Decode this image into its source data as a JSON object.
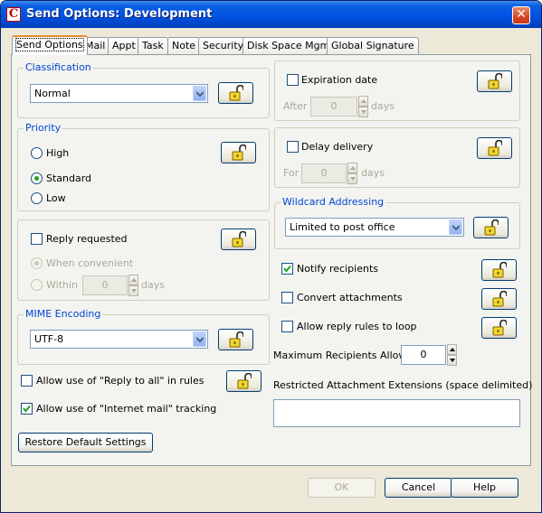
{
  "window": {
    "title": "Send Options:  Development",
    "app_icon": "C"
  },
  "tabs": [
    "Send Options",
    "Mail",
    "Appt",
    "Task",
    "Note",
    "Security",
    "Disk Space Mgmt",
    "Global Signature"
  ],
  "classification": {
    "legend": "Classification",
    "value": "Normal"
  },
  "priority": {
    "legend": "Priority",
    "options": [
      "High",
      "Standard",
      "Low"
    ],
    "selected": "Standard"
  },
  "reply": {
    "label": "Reply requested",
    "checked": false,
    "when_convenient": "When convenient",
    "within": "Within",
    "within_value": "0",
    "days": "days"
  },
  "mime": {
    "legend": "MIME Encoding",
    "value": "UTF-8"
  },
  "allow_reply_all": {
    "label": "Allow use of  \"Reply to all\" in rules",
    "checked": false
  },
  "allow_internet_tracking": {
    "label": "Allow use of  \"Internet mail\" tracking",
    "checked": true
  },
  "restore_button": "Restore Default Settings",
  "expiration": {
    "label": "Expiration date",
    "checked": false,
    "after": "After",
    "value": "0",
    "days": "days"
  },
  "delay": {
    "label": "Delay delivery",
    "checked": false,
    "for": "For",
    "value": "0",
    "days": "days"
  },
  "wildcard": {
    "legend": "Wildcard Addressing",
    "value": "Limited to post office"
  },
  "notify": {
    "label": "Notify recipients",
    "checked": true
  },
  "convert": {
    "label": "Convert attachments",
    "checked": false
  },
  "reply_rules_loop": {
    "label": "Allow reply rules to loop",
    "checked": false
  },
  "max_recipients": {
    "label": "Maximum Recipients Allowed",
    "value": "0"
  },
  "restricted_ext": {
    "label": "Restricted Attachment Extensions (space delimited)",
    "value": ""
  },
  "buttons": {
    "ok": "OK",
    "cancel": "Cancel",
    "help": "Help"
  },
  "icons": {
    "lock": "unlocked-padlock-icon",
    "close": "close-icon",
    "dropdown": "chevron-down-icon"
  }
}
